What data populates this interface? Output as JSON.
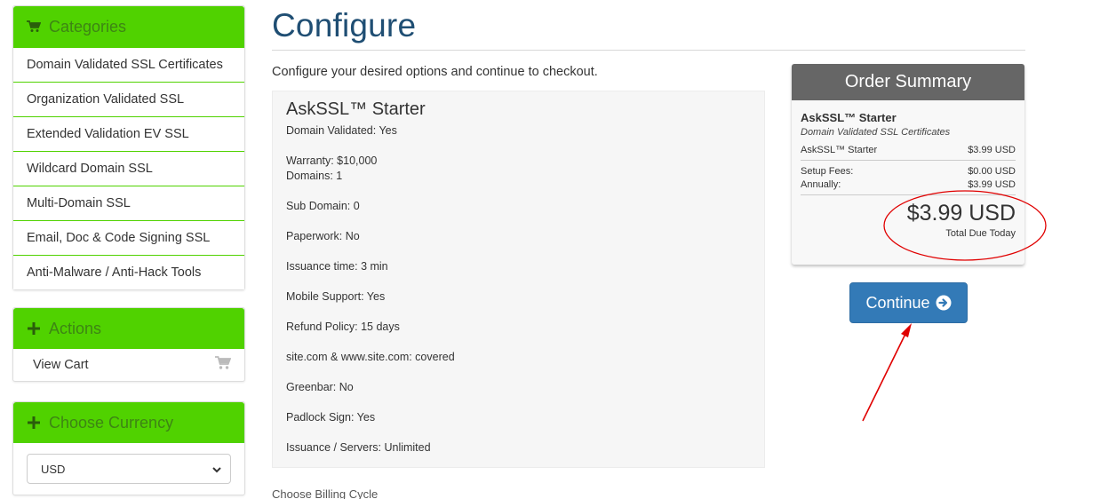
{
  "sidebar": {
    "categories": {
      "title": "Categories",
      "items": [
        {
          "label": "Domain Validated SSL Certificates"
        },
        {
          "label": "Organization Validated SSL"
        },
        {
          "label": "Extended Validation EV SSL"
        },
        {
          "label": "Wildcard Domain SSL"
        },
        {
          "label": "Multi-Domain SSL"
        },
        {
          "label": "Email, Doc & Code Signing SSL"
        },
        {
          "label": "Anti-Malware / Anti-Hack Tools"
        }
      ]
    },
    "actions": {
      "title": "Actions",
      "view_cart": "View Cart"
    },
    "currency": {
      "title": "Choose Currency",
      "selected": "USD"
    }
  },
  "main": {
    "title": "Configure",
    "intro": "Configure your desired options and continue to checkout.",
    "product": {
      "name": "AskSSL™ Starter",
      "features": [
        "Domain Validated: Yes",
        "Warranty: $10,000",
        "Domains: 1",
        "Sub Domain: 0",
        "Paperwork: No",
        "Issuance time: 3 min",
        "Mobile Support: Yes",
        "Refund Policy: 15 days",
        "site.com & www.site.com: covered",
        "Greenbar: No",
        "Padlock Sign: Yes",
        "Issuance / Servers: Unlimited"
      ]
    },
    "billing_label": "Choose Billing Cycle"
  },
  "summary": {
    "title": "Order Summary",
    "product_name": "AskSSL™ Starter",
    "product_category": "Domain Validated SSL Certificates",
    "line_item": {
      "label": "AskSSL™ Starter",
      "value": "$3.99 USD"
    },
    "setup_fees": {
      "label": "Setup Fees:",
      "value": "$0.00 USD"
    },
    "annually": {
      "label": "Annually:",
      "value": "$3.99 USD"
    },
    "total": "$3.99 USD",
    "total_label": "Total Due Today"
  },
  "continue_label": "Continue",
  "colors": {
    "sidebar_header": "#50d200",
    "title": "#1f4e73",
    "summary_header": "#666666",
    "button": "#337ab7",
    "annotation": "#e00000"
  }
}
